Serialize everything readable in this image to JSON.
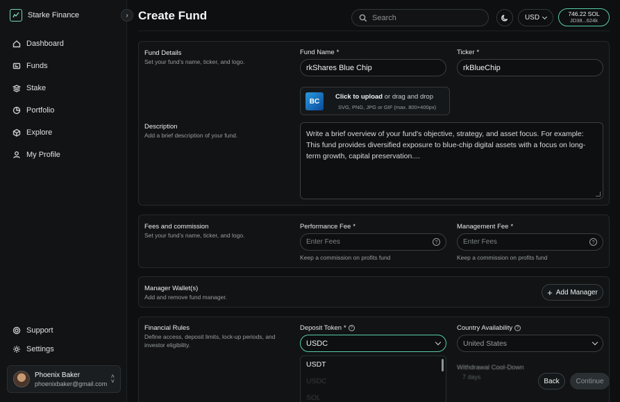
{
  "brand": {
    "name": "Starke Finance"
  },
  "sidebar": {
    "items": [
      {
        "label": "Dashboard",
        "icon": "home-icon"
      },
      {
        "label": "Funds",
        "icon": "funds-icon"
      },
      {
        "label": "Stake",
        "icon": "stack-icon"
      },
      {
        "label": "Portfolio",
        "icon": "pie-chart-icon"
      },
      {
        "label": "Explore",
        "icon": "cube-icon"
      },
      {
        "label": "My Profile",
        "icon": "user-icon"
      }
    ],
    "bottom_items": [
      {
        "label": "Support",
        "icon": "support-icon"
      },
      {
        "label": "Settings",
        "icon": "gear-icon"
      }
    ],
    "profile": {
      "name": "Phoenix Baker",
      "email": "phoenixbaker@gmail.com"
    }
  },
  "header": {
    "title": "Create Fund",
    "search_placeholder": "Search",
    "currency": "USD",
    "wallet_balance": "746.22 SOL",
    "wallet_address": "JD38...624k"
  },
  "fund_details": {
    "title": "Fund Details",
    "desc": "Set your fund’s name, ticker, and logo.",
    "fund_name_label": "Fund Name",
    "fund_name_value": "rkShares Blue Chip",
    "ticker_label": "Ticker",
    "ticker_value": "rkBlueChip",
    "upload_logo_text": "BC",
    "upload_cta": "Click to upload",
    "upload_rest": "or drag and drop",
    "upload_hint": "SVG, PNG, JPG or GIF (max. 800×400px)",
    "description_title": "Description",
    "description_desc": "Add a brief description of your fund.",
    "description_text": "Write a brief overview of your fund's objective, strategy, and asset focus. For example: This fund provides diversified exposure to blue-chip digital assets with a focus on long-term growth, capital preservation...."
  },
  "fees": {
    "title": "Fees and commission",
    "desc": "Set your fund’s name, ticker, and logo.",
    "performance_label": "Performance Fee",
    "performance_placeholder": "Enter Fees",
    "performance_hint": "Keep a commission on profits fund",
    "management_label": "Management Fee",
    "management_placeholder": "Enter Fees",
    "management_hint": "Keep a commission on profits fund"
  },
  "managers": {
    "title": "Manager Wallet(s)",
    "desc": "Add and remove fund manager.",
    "add_label": "Add Manager"
  },
  "financial_rules": {
    "title": "Financial Rules",
    "desc": "Define access, deposit limits, lock-up periods, and investor eligibility.",
    "deposit_label": "Deposit Token",
    "deposit_value": "USDC",
    "country_label": "Country Availability",
    "country_value": "United States",
    "dropdown_options": [
      "USDT",
      "USDC",
      "SOL"
    ],
    "withdrawal_label": "Withdrawal Cool-Down",
    "withdrawal_value": "7 days"
  },
  "footer": {
    "back_label": "Back",
    "continue_label": "Continue"
  },
  "colors": {
    "accent": "#57cfa7",
    "background": "#0d0f10",
    "panel": "#111314"
  }
}
